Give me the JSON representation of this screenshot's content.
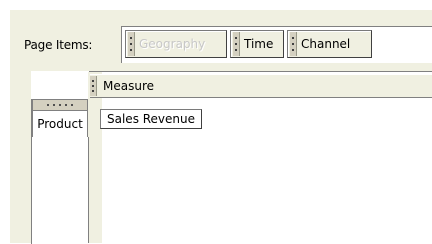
{
  "page_items": {
    "label": "Page Items:",
    "dimensions": [
      {
        "label": "Geography",
        "enabled": false
      },
      {
        "label": "Time",
        "enabled": true
      },
      {
        "label": "Channel",
        "enabled": true
      }
    ]
  },
  "columns": {
    "dimension_label": "Measure",
    "value_label": "Sales Revenue"
  },
  "rows": {
    "dimension_label": "Product"
  }
}
